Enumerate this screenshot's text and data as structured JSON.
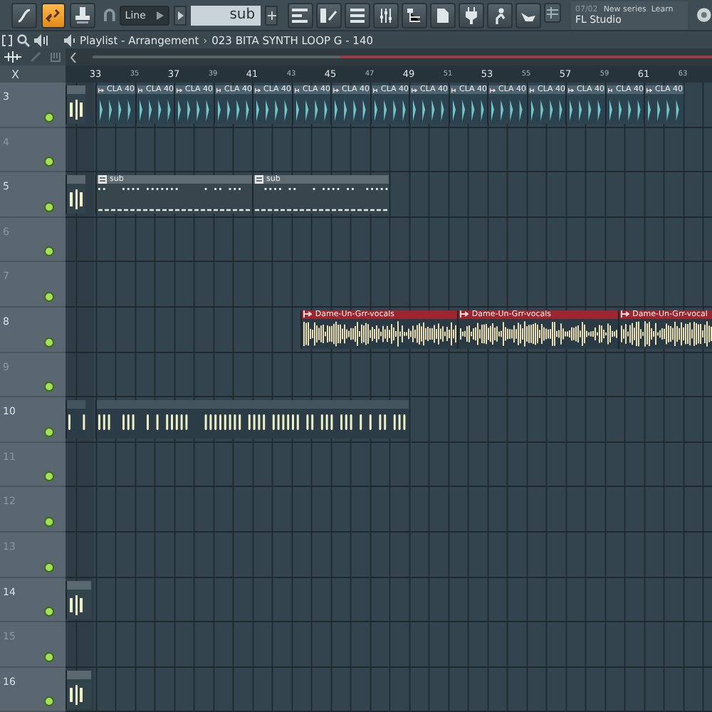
{
  "toolbar": {
    "snap": "Line",
    "pattern": "sub",
    "hint_counter": "07/02",
    "hint_title": "New series  Learn",
    "hint_text": "FL Studio",
    "link_on": true
  },
  "playlist": {
    "title": "Playlist - Arrangement",
    "separator": "›",
    "arrangement": "023 BITA SYNTH LOOP G - 140",
    "corner_mark": "X"
  },
  "ruler": [
    {
      "label": "33",
      "major": true
    },
    {
      "label": "35",
      "major": false
    },
    {
      "label": "37",
      "major": true
    },
    {
      "label": "39",
      "major": false
    },
    {
      "label": "41",
      "major": true
    },
    {
      "label": "43",
      "major": false
    },
    {
      "label": "45",
      "major": true
    },
    {
      "label": "47",
      "major": false
    },
    {
      "label": "49",
      "major": true
    },
    {
      "label": "51",
      "major": false
    },
    {
      "label": "53",
      "major": true
    },
    {
      "label": "55",
      "major": false
    },
    {
      "label": "57",
      "major": true
    },
    {
      "label": "59",
      "major": false
    },
    {
      "label": "61",
      "major": true
    },
    {
      "label": "63",
      "major": false
    }
  ],
  "tracks": [
    {
      "label": "3",
      "clips": [
        {
          "kind": "stub"
        },
        {
          "kind": "cla",
          "name": "CLA 40"
        },
        {
          "kind": "cla",
          "name": "CLA 40"
        },
        {
          "kind": "cla",
          "name": "CLA 40"
        },
        {
          "kind": "cla",
          "name": "CLA 40"
        },
        {
          "kind": "cla",
          "name": "CLA 40"
        },
        {
          "kind": "cla",
          "name": "CLA 40"
        },
        {
          "kind": "cla",
          "name": "CLA 40"
        },
        {
          "kind": "cla",
          "name": "CLA 40"
        },
        {
          "kind": "cla",
          "name": "CLA 40"
        },
        {
          "kind": "cla",
          "name": "CLA 40"
        },
        {
          "kind": "cla",
          "name": "CLA 40"
        },
        {
          "kind": "cla",
          "name": "CLA 40"
        },
        {
          "kind": "cla",
          "name": "CLA 40"
        },
        {
          "kind": "cla",
          "name": "CLA 40"
        },
        {
          "kind": "cla",
          "name": "CLA 40"
        }
      ]
    },
    {
      "label": "4"
    },
    {
      "label": "5",
      "clips": [
        {
          "kind": "stub"
        },
        {
          "kind": "pattern",
          "name": "sub"
        },
        {
          "kind": "pattern",
          "name": "sub"
        }
      ]
    },
    {
      "label": "6"
    },
    {
      "label": "7"
    },
    {
      "label": "8",
      "clips": [
        {
          "kind": "audio",
          "name": "Dame-Un-Grr-vocals"
        },
        {
          "kind": "audio",
          "name": "Dame-Un-Grr-vocals"
        },
        {
          "kind": "audio",
          "name": "Dame-Un-Grr-vocal"
        }
      ]
    },
    {
      "label": "9"
    },
    {
      "label": "10",
      "clips": [
        {
          "kind": "blips"
        },
        {
          "kind": "blips"
        }
      ]
    },
    {
      "label": "11"
    },
    {
      "label": "12"
    },
    {
      "label": "13"
    },
    {
      "label": "14",
      "clips": [
        {
          "kind": "stub"
        }
      ]
    },
    {
      "label": "15"
    },
    {
      "label": "16",
      "clips": [
        {
          "kind": "stub"
        }
      ]
    }
  ]
}
